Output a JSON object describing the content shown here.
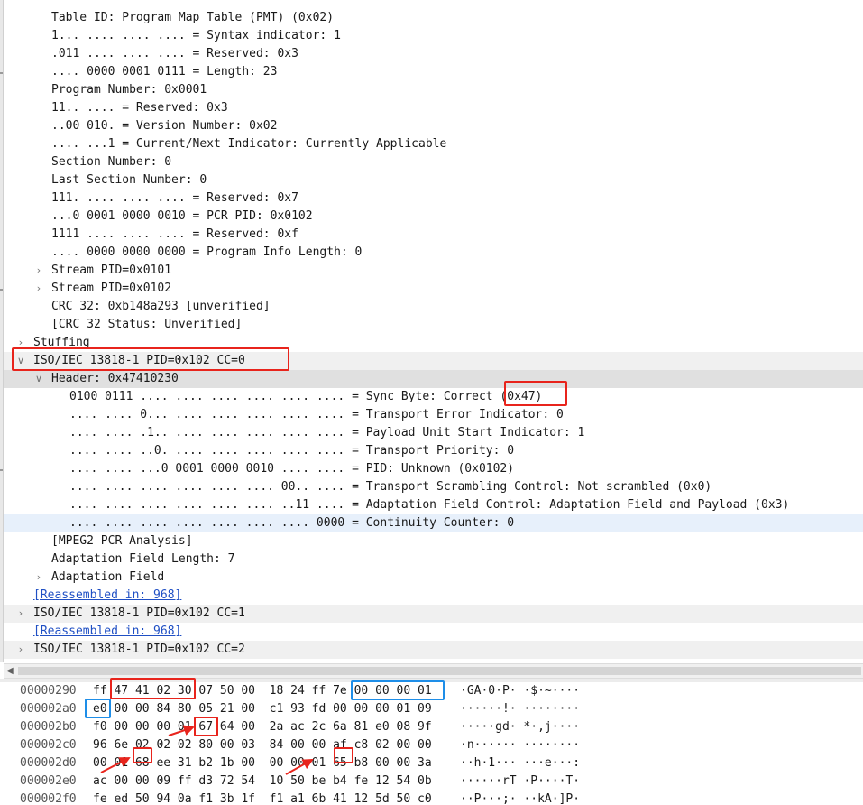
{
  "packet_details": {
    "rows": [
      {
        "indent": 2,
        "expander": "",
        "text": "Table ID: Program Map Table (PMT) (0x02)"
      },
      {
        "indent": 2,
        "expander": "",
        "text": "1... .... .... .... = Syntax indicator: 1"
      },
      {
        "indent": 2,
        "expander": "",
        "text": ".011 .... .... .... = Reserved: 0x3"
      },
      {
        "indent": 2,
        "expander": "",
        "text": ".... 0000 0001 0111 = Length: 23"
      },
      {
        "indent": 2,
        "expander": "",
        "text": "Program Number: 0x0001"
      },
      {
        "indent": 2,
        "expander": "",
        "text": "11.. .... = Reserved: 0x3"
      },
      {
        "indent": 2,
        "expander": "",
        "text": "..00 010. = Version Number: 0x02"
      },
      {
        "indent": 2,
        "expander": "",
        "text": ".... ...1 = Current/Next Indicator: Currently Applicable"
      },
      {
        "indent": 2,
        "expander": "",
        "text": "Section Number: 0"
      },
      {
        "indent": 2,
        "expander": "",
        "text": "Last Section Number: 0"
      },
      {
        "indent": 2,
        "expander": "",
        "text": "111. .... .... .... = Reserved: 0x7"
      },
      {
        "indent": 2,
        "expander": "",
        "text": "...0 0001 0000 0010 = PCR PID: 0x0102"
      },
      {
        "indent": 2,
        "expander": "",
        "text": "1111 .... .... .... = Reserved: 0xf"
      },
      {
        "indent": 2,
        "expander": "",
        "text": ".... 0000 0000 0000 = Program Info Length: 0"
      },
      {
        "indent": 2,
        "expander": "collapsed",
        "text": "Stream PID=0x0101"
      },
      {
        "indent": 2,
        "expander": "collapsed",
        "text": "Stream PID=0x0102"
      },
      {
        "indent": 2,
        "expander": "",
        "text": "CRC 32: 0xb148a293 [unverified]"
      },
      {
        "indent": 2,
        "expander": "",
        "text": "[CRC 32 Status: Unverified]"
      },
      {
        "indent": 1,
        "expander": "collapsed",
        "text": "Stuffing"
      },
      {
        "indent": 1,
        "expander": "expanded",
        "text": "ISO/IEC 13818-1 PID=0x102 CC=0",
        "style": "alt"
      },
      {
        "indent": 2,
        "expander": "expanded",
        "text": "Header: 0x47410230",
        "style": "hdrsel"
      },
      {
        "indent": 3,
        "expander": "",
        "text": "0100 0111 .... .... .... .... .... .... = Sync Byte: Correct (0x47)"
      },
      {
        "indent": 3,
        "expander": "",
        "text": ".... .... 0... .... .... .... .... .... = Transport Error Indicator: 0"
      },
      {
        "indent": 3,
        "expander": "",
        "text": ".... .... .1.. .... .... .... .... .... = Payload Unit Start Indicator: 1"
      },
      {
        "indent": 3,
        "expander": "",
        "text": ".... .... ..0. .... .... .... .... .... = Transport Priority: 0"
      },
      {
        "indent": 3,
        "expander": "",
        "text": ".... .... ...0 0001 0000 0010 .... .... = PID: Unknown (0x0102)"
      },
      {
        "indent": 3,
        "expander": "",
        "text": ".... .... .... .... .... .... 00.. .... = Transport Scrambling Control: Not scrambled (0x0)"
      },
      {
        "indent": 3,
        "expander": "",
        "text": ".... .... .... .... .... .... ..11 .... = Adaptation Field Control: Adaptation Field and Payload (0x3)"
      },
      {
        "indent": 3,
        "expander": "",
        "text": ".... .... .... .... .... .... .... 0000 = Continuity Counter: 0",
        "style": "sel"
      },
      {
        "indent": 2,
        "expander": "",
        "text": "[MPEG2 PCR Analysis]"
      },
      {
        "indent": 2,
        "expander": "",
        "text": "Adaptation Field Length: 7"
      },
      {
        "indent": 2,
        "expander": "collapsed",
        "text": "Adaptation Field"
      },
      {
        "indent": 1,
        "expander": "",
        "text": "[Reassembled in: 968]",
        "link": true
      },
      {
        "indent": 1,
        "expander": "collapsed",
        "text": "ISO/IEC 13818-1 PID=0x102 CC=1",
        "style": "alt"
      },
      {
        "indent": 1,
        "expander": "",
        "text": "[Reassembled in: 968]",
        "link": true
      },
      {
        "indent": 1,
        "expander": "collapsed",
        "text": "ISO/IEC 13818-1 PID=0x102 CC=2",
        "style": "alt"
      }
    ]
  },
  "packet_bytes": {
    "rows": [
      {
        "offset": "00000290",
        "hex": "ff 47 41 02 30 07 50 00  18 24 ff 7e 00 00 00 01",
        "ascii": "·GA·0·P· ·$·~····"
      },
      {
        "offset": "000002a0",
        "hex": "e0 00 00 84 80 05 21 00  c1 93 fd 00 00 00 01 09",
        "ascii": "······!· ········"
      },
      {
        "offset": "000002b0",
        "hex": "f0 00 00 00 01 67 64 00  2a ac 2c 6a 81 e0 08 9f",
        "ascii": "·····gd· *·,j····"
      },
      {
        "offset": "000002c0",
        "hex": "96 6e 02 02 02 80 00 03  84 00 00 af c8 02 00 00",
        "ascii": "·n······ ········"
      },
      {
        "offset": "000002d0",
        "hex": "00 01 68 ee 31 b2 1b 00  00 00 01 65 b8 00 00 3a",
        "ascii": "··h·1··· ···e···:"
      },
      {
        "offset": "000002e0",
        "hex": "ac 00 00 09 ff d3 72 54  10 50 be b4 fe 12 54 0b",
        "ascii": "······rT ·P····T·"
      },
      {
        "offset": "000002f0",
        "hex": "fe ed 50 94 0a f1 3b 1f  f1 a1 6b 41 12 5d 50 c0",
        "ascii": "··P···;· ··kA·]P·"
      }
    ]
  },
  "annotation_colors": {
    "red": "#e8241c",
    "blue": "#1e8ee8"
  },
  "icons": {
    "collapsed": "chevron-right-icon",
    "expanded": "chevron-down-icon",
    "scroll_left": "arrow-left-icon"
  }
}
